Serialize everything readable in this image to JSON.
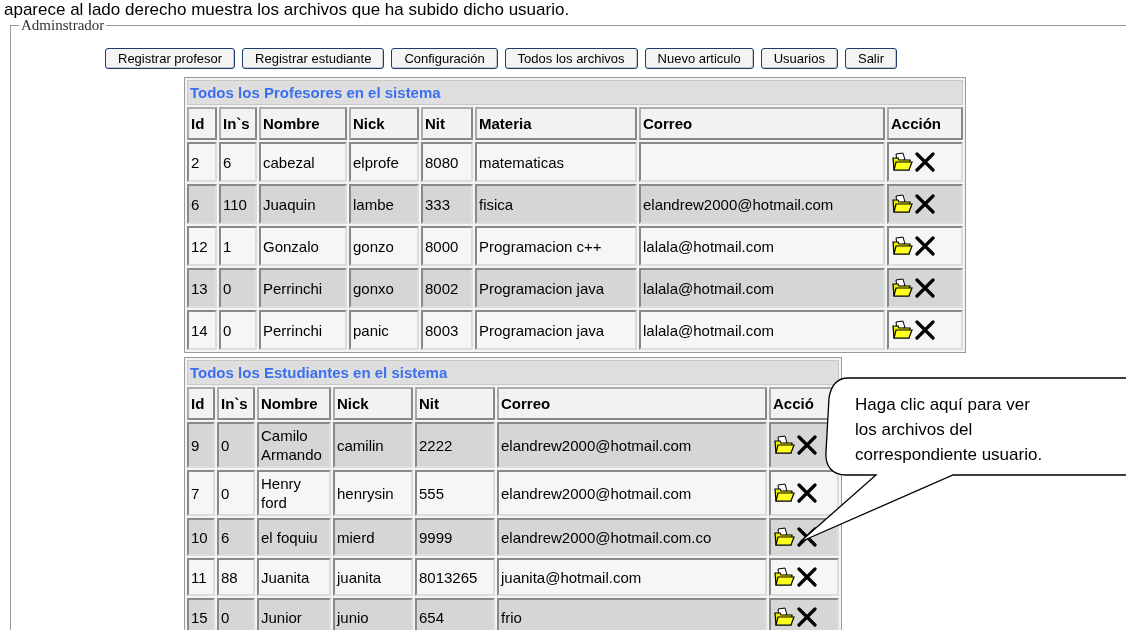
{
  "page_caption": "aparece al lado derecho muestra los archivos que ha subido dicho usuario.",
  "fieldset": {
    "legend": "Adminstrador"
  },
  "nav_buttons": [
    "Registrar profesor",
    "Registrar estudiante",
    "Configuración",
    "Todos los archivos",
    "Nuevo articulo",
    "Usuarios",
    "Salir"
  ],
  "professors_table": {
    "title": "Todos los Profesores en el sistema",
    "columns": [
      "Id",
      "In`s",
      "Nombre",
      "Nick",
      "Nit",
      "Materia",
      "Correo",
      "Acción"
    ],
    "rows": [
      {
        "cells": [
          "2",
          "6",
          "cabezal",
          "elprofe",
          "8080",
          "matematicas",
          null
        ]
      },
      {
        "cells": [
          "6",
          "110",
          "Juaquin",
          "lambe",
          "333",
          "fisica",
          "elandrew2000@hotmail.com"
        ]
      },
      {
        "cells": [
          "12",
          "1",
          "Gonzalo",
          "gonzo",
          "8000",
          "Programacion c++",
          "lalala@hotmail.com"
        ]
      },
      {
        "cells": [
          "13",
          "0",
          "Perrinchi",
          "gonxo",
          "8002",
          "Programacion java",
          "lalala@hotmail.com"
        ]
      },
      {
        "cells": [
          "14",
          "0",
          "Perrinchi",
          "panic",
          "8003",
          "Programacion java",
          "lalala@hotmail.com"
        ]
      }
    ]
  },
  "students_table": {
    "title": "Todos los Estudiantes en el sistema",
    "columns": [
      "Id",
      "In`s",
      "Nombre",
      "Nick",
      "Nit",
      "Correo",
      "Acció"
    ],
    "rows": [
      {
        "cells": [
          "9",
          "0",
          "Camilo Armando",
          "camilin",
          "2222",
          "elandrew2000@hotmail.com"
        ]
      },
      {
        "cells": [
          "7",
          "0",
          "Henry ford",
          "henrysin",
          "555",
          "elandrew2000@hotmail.com"
        ]
      },
      {
        "cells": [
          "10",
          "6",
          "el foquiu",
          "mierd",
          "9999",
          "elandrew2000@hotmail.com.co"
        ]
      },
      {
        "cells": [
          "11",
          "88",
          "Juanita",
          "juanita",
          "8013265",
          "juanita@hotmail.com"
        ]
      },
      {
        "cells": [
          "15",
          "0",
          "Junior",
          "junio",
          "654",
          "frio"
        ]
      }
    ]
  },
  "callout": {
    "text": "Haga clic aquí para ver los archivos del correspondiente usuario."
  }
}
